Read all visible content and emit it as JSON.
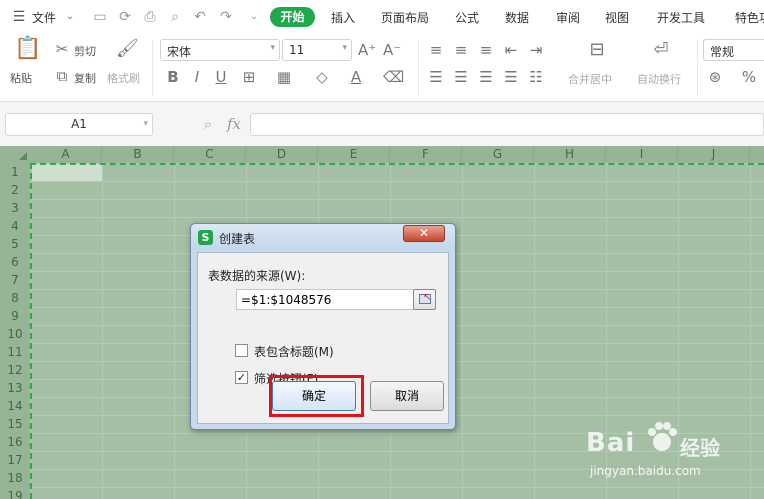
{
  "menubar": {
    "file_label": "文件",
    "tabs": [
      "开始",
      "插入",
      "页面布局",
      "公式",
      "数据",
      "审阅",
      "视图",
      "开发工具",
      "特色功"
    ]
  },
  "ribbon": {
    "paste": "粘贴",
    "cut": "剪切",
    "copy": "复制",
    "format_painter": "格式刷",
    "font_name": "宋体",
    "font_size": "11",
    "merge_center": "合并居中",
    "wrap_text": "自动换行",
    "number_format": "常规",
    "percent": "%"
  },
  "formula_bar": {
    "name_box": "A1",
    "fx": "fx",
    "value": ""
  },
  "sheet": {
    "columns": [
      "A",
      "B",
      "C",
      "D",
      "E",
      "F",
      "G",
      "H",
      "I",
      "J"
    ],
    "rows": [
      "1",
      "2",
      "3",
      "4",
      "5",
      "6",
      "7",
      "8",
      "9",
      "10",
      "11",
      "12",
      "13",
      "14",
      "15",
      "16",
      "17",
      "18",
      "19"
    ]
  },
  "dialog": {
    "title": "创建表",
    "source_label": "表数据的来源(W):",
    "range_value": "=$1:$1048576",
    "header_checkbox": {
      "label": "表包含标题(M)",
      "checked": false
    },
    "filter_checkbox": {
      "label": "筛选按钮(F)",
      "checked": true
    },
    "ok_label": "确定",
    "cancel_label": "取消",
    "close_glyph": "✕"
  },
  "colors": {
    "accent": "#1fa84c",
    "highlight": "#e3121b",
    "grid": "#a4bfa4"
  },
  "watermark": {
    "logo": "Bai",
    "name": "经验",
    "url": "jingyan.baidu.com"
  }
}
